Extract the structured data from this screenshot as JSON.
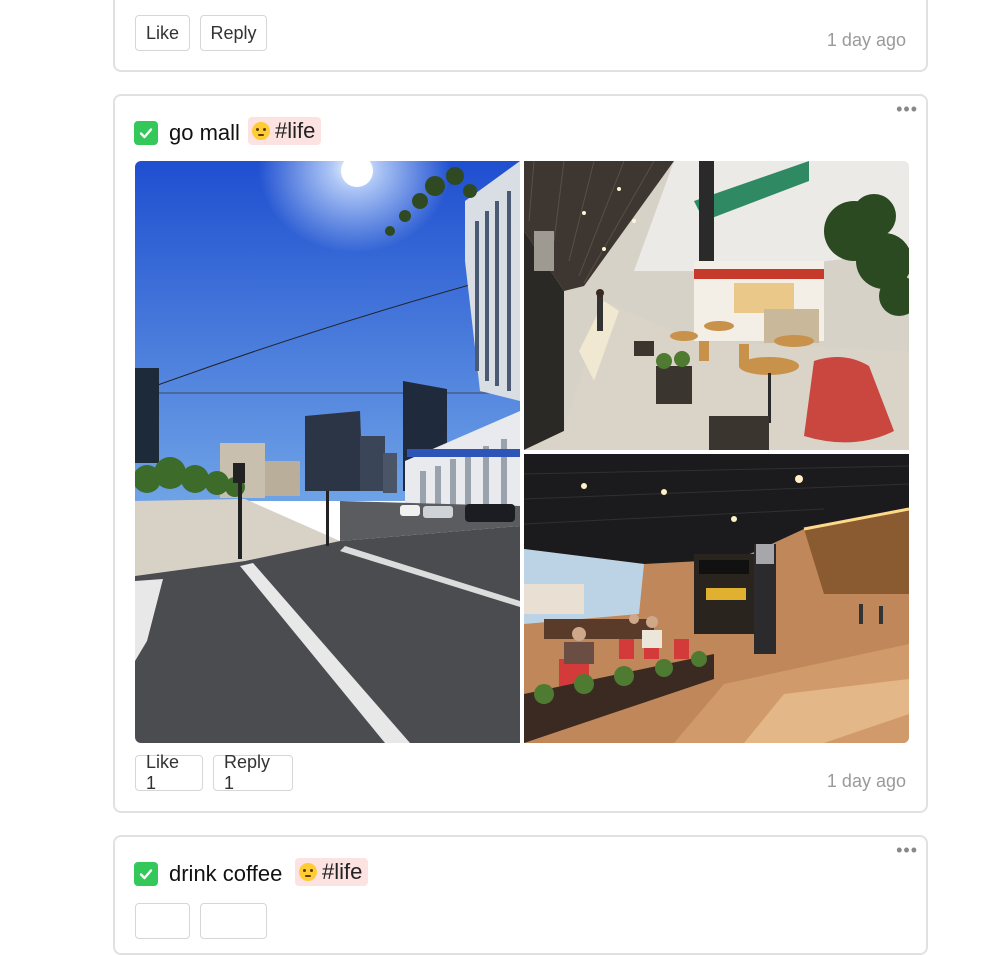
{
  "posts": [
    {
      "actions": {
        "like_label": "Like",
        "reply_label": "Reply"
      },
      "timestamp": "1 day ago"
    },
    {
      "title": "go mall",
      "tag": "#life",
      "more": "•••",
      "photos": [
        "street-photo",
        "food-court-photo",
        "mall-corridor-photo"
      ],
      "actions": {
        "like_label": "Like 1",
        "reply_label": "Reply 1"
      },
      "timestamp": "1 day ago"
    },
    {
      "title": "drink coffee",
      "tag": "#life",
      "more": "•••"
    }
  ],
  "colors": {
    "check": "#34c759",
    "tag_bg": "#fde2e2",
    "border": "#e1e1e1"
  }
}
